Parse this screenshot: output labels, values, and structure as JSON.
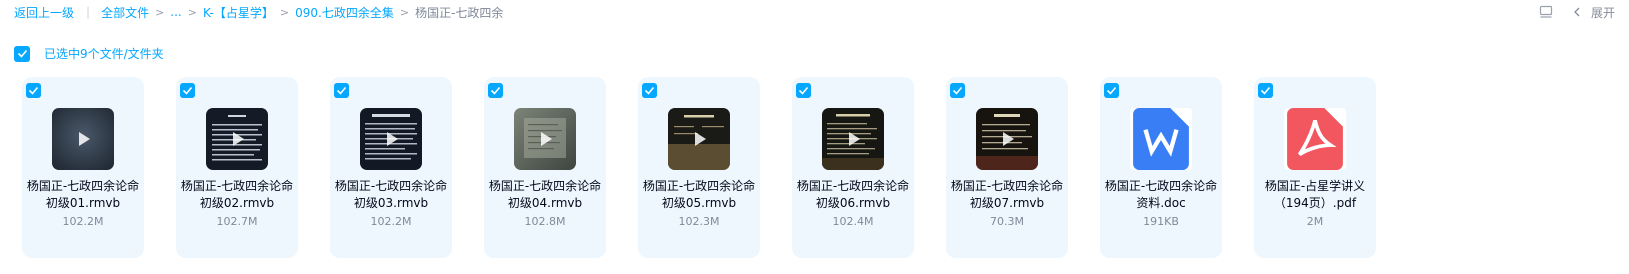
{
  "breadcrumb": {
    "back_label": "返回上一级",
    "items": [
      "全部文件",
      "...",
      "K-【占星学】",
      "090.七政四余全集"
    ],
    "current": "杨国正-七政四余"
  },
  "toolbar": {
    "expand_label": "展开"
  },
  "selection": {
    "label": "已选中9个文件/文件夹",
    "checked": true
  },
  "files": [
    {
      "name": "杨国正-七政四余论命初级01.rmvb",
      "size": "102.2M",
      "type": "video",
      "thumb_icon": "video-thumbnail",
      "checked": true
    },
    {
      "name": "杨国正-七政四余论命初级02.rmvb",
      "size": "102.7M",
      "type": "video",
      "thumb_icon": "video-thumbnail",
      "checked": true
    },
    {
      "name": "杨国正-七政四余论命初级03.rmvb",
      "size": "102.2M",
      "type": "video",
      "thumb_icon": "video-thumbnail",
      "checked": true
    },
    {
      "name": "杨国正-七政四余论命初级04.rmvb",
      "size": "102.8M",
      "type": "video",
      "thumb_icon": "video-thumbnail",
      "checked": true
    },
    {
      "name": "杨国正-七政四余论命初级05.rmvb",
      "size": "102.3M",
      "type": "video",
      "thumb_icon": "video-thumbnail",
      "checked": true
    },
    {
      "name": "杨国正-七政四余论命初级06.rmvb",
      "size": "102.4M",
      "type": "video",
      "thumb_icon": "video-thumbnail",
      "checked": true
    },
    {
      "name": "杨国正-七政四余论命初级07.rmvb",
      "size": "70.3M",
      "type": "video",
      "thumb_icon": "video-thumbnail",
      "checked": true
    },
    {
      "name": "杨国正-七政四余论命资料.doc",
      "size": "191KB",
      "type": "doc",
      "thumb_icon": "word-doc-icon",
      "checked": true
    },
    {
      "name": "杨国正-占星学讲义（194页）.pdf",
      "size": "2M",
      "type": "pdf",
      "thumb_icon": "pdf-icon",
      "checked": true
    }
  ],
  "colors": {
    "accent": "#06a7ff",
    "card_bg": "#eef7fe",
    "word_badge": "#3a7ef6",
    "pdf_badge": "#f2565e"
  }
}
